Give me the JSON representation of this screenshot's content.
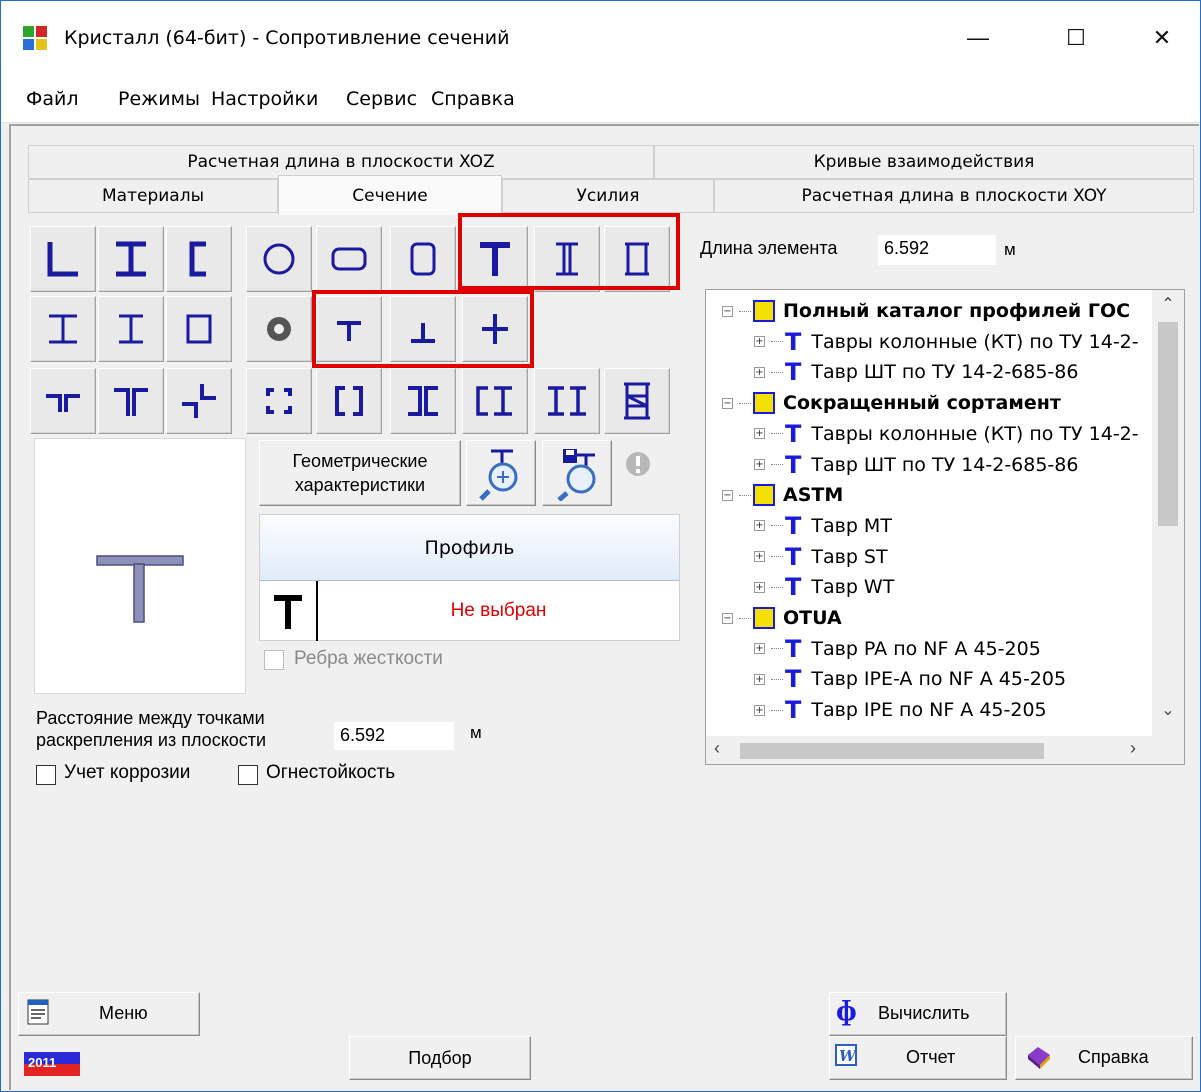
{
  "window": {
    "title": "Кристалл (64-бит) - Сопротивление сечений",
    "minimize": "—",
    "maximize": "☐",
    "close": "✕"
  },
  "menu": [
    "Файл",
    "Режимы",
    "Настройки",
    "Сервис",
    "Справка"
  ],
  "tabs_row1": [
    "Расчетная длина в плоскости XOZ",
    "Кривые взаимодействия"
  ],
  "tabs_row2": [
    "Материалы",
    "Сечение",
    "Усилия",
    "Расчетная длина в плоскости XOY"
  ],
  "active_tab": "Сечение",
  "section_buttons": {
    "row1": [
      "angle-icon",
      "i-beam-icon",
      "channel-icon",
      "circle-icon",
      "rounded-rect-icon",
      "round-box-icon",
      "tee-icon",
      "double-i-icon",
      "welded-box-icon"
    ],
    "row2": [
      "welded-i-icon",
      "welded-i2-icon",
      "box-icon",
      "ring-icon",
      "small-tee-icon",
      "inverted-tee-icon",
      "cross-icon"
    ],
    "row3": [
      "double-angle-tee-icon",
      "double-angle-pi-icon",
      "offset-angles-icon",
      "four-angles-box-icon",
      "double-channel-box-icon",
      "back-channels-icon",
      "channel-i-icon",
      "double-i-plate-icon",
      "latticed-icon"
    ]
  },
  "geom_button": "Геометрические характеристики",
  "profile_table": {
    "header": "Профиль",
    "value": "Не выбран"
  },
  "stiffener_label": "Ребра жесткости",
  "distance": {
    "label_line1": "Расстояние между точками",
    "label_line2": "раскрепления из плоскости",
    "value": "6.592",
    "unit": "м"
  },
  "corrosion_label": "Учет коррозии",
  "fire_label": "Огнестойкость",
  "length": {
    "label": "Длина элемента",
    "value": "6.592",
    "unit": "м"
  },
  "tree": [
    {
      "level": 0,
      "text": "Полный каталог профилей ГОС"
    },
    {
      "level": 1,
      "text": "Тавры колонные (КТ) по ТУ 14-2-"
    },
    {
      "level": 1,
      "text": "Тавр ШТ по ТУ 14-2-685-86"
    },
    {
      "level": 0,
      "text": "Сокращенный сортамент"
    },
    {
      "level": 1,
      "text": "Тавры колонные (КТ) по ТУ 14-2-"
    },
    {
      "level": 1,
      "text": "Тавр ШТ по ТУ 14-2-685-86"
    },
    {
      "level": 0,
      "text": "ASTM"
    },
    {
      "level": 1,
      "text": "Тавр MT"
    },
    {
      "level": 1,
      "text": "Тавр ST"
    },
    {
      "level": 1,
      "text": "Тавр WT"
    },
    {
      "level": 0,
      "text": "OTUA"
    },
    {
      "level": 1,
      "text": "Тавр PA по NF A 45-205"
    },
    {
      "level": 1,
      "text": "Тавр IPE-A по NF A 45-205"
    },
    {
      "level": 1,
      "text": "Тавр IPE по NF A 45-205"
    }
  ],
  "bottom": {
    "menu": "Меню",
    "year": "2011",
    "select": "Подбор",
    "calculate": "Вычислить",
    "report": "Отчет",
    "help": "Справка"
  }
}
